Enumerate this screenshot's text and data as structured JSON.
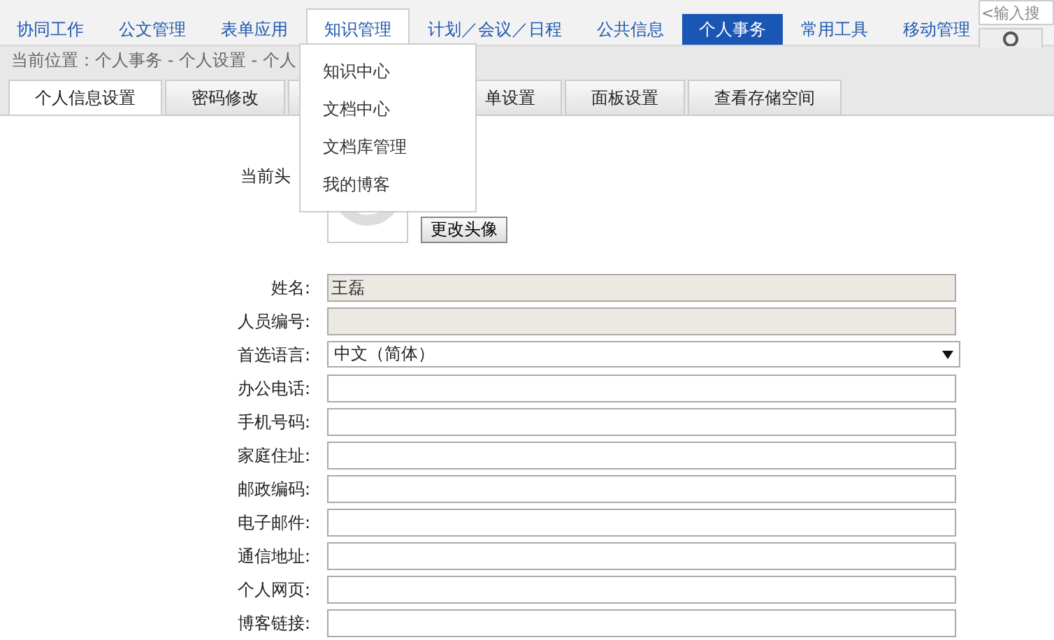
{
  "nav": {
    "items": [
      {
        "label": "协同工作",
        "selected": false,
        "expanded": false
      },
      {
        "label": "公文管理",
        "selected": false,
        "expanded": false
      },
      {
        "label": "表单应用",
        "selected": false,
        "expanded": false
      },
      {
        "label": "知识管理",
        "selected": false,
        "expanded": true
      },
      {
        "label": "计划／会议／日程",
        "selected": false,
        "expanded": false
      },
      {
        "label": "公共信息",
        "selected": false,
        "expanded": false
      },
      {
        "label": "个人事务",
        "selected": true,
        "expanded": false
      },
      {
        "label": "常用工具",
        "selected": false,
        "expanded": false
      },
      {
        "label": "移动管理",
        "selected": false,
        "expanded": false
      }
    ]
  },
  "search": {
    "placeholder": "<输入搜"
  },
  "breadcrumb": "当前位置：个人事务 - 个人设置 - 个人",
  "dropdown": {
    "items": [
      "知识中心",
      "文档中心",
      "文档库管理",
      "我的博客"
    ]
  },
  "tabs": [
    {
      "label": "个人信息设置",
      "selected": true
    },
    {
      "label": "密码修改",
      "selected": false
    },
    {
      "label": "单设置",
      "selected": false
    },
    {
      "label": "面板设置",
      "selected": false
    },
    {
      "label": "查看存储空间",
      "selected": false
    }
  ],
  "avatar": {
    "label": "当前头",
    "button": "更改头像"
  },
  "fields": [
    {
      "label": "姓名:",
      "kind": "readonly",
      "value": "王磊"
    },
    {
      "label": "人员编号:",
      "kind": "readonly"
    },
    {
      "label": "首选语言:",
      "kind": "select",
      "value": "中文（简体）"
    },
    {
      "label": "办公电话:",
      "kind": "text"
    },
    {
      "label": "手机号码:",
      "kind": "text"
    },
    {
      "label": "家庭住址:",
      "kind": "text"
    },
    {
      "label": "邮政编码:",
      "kind": "text"
    },
    {
      "label": "电子邮件:",
      "kind": "text"
    },
    {
      "label": "通信地址:",
      "kind": "text"
    },
    {
      "label": "个人网页:",
      "kind": "text"
    },
    {
      "label": "博客链接:",
      "kind": "text"
    }
  ]
}
